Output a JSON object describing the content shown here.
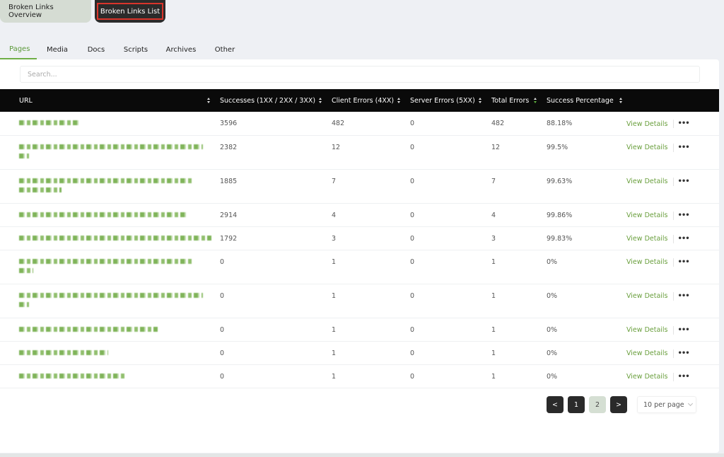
{
  "view_tabs": [
    {
      "label": "Broken Links Overview",
      "active": false
    },
    {
      "label": "Broken Links List",
      "active": true
    }
  ],
  "sub_tabs": [
    {
      "label": "Pages",
      "active": true
    },
    {
      "label": "Media",
      "active": false
    },
    {
      "label": "Docs",
      "active": false
    },
    {
      "label": "Scripts",
      "active": false
    },
    {
      "label": "Archives",
      "active": false
    },
    {
      "label": "Other",
      "active": false
    }
  ],
  "search": {
    "placeholder": "Search...",
    "value": ""
  },
  "table": {
    "columns": [
      {
        "label": "URL",
        "sortable": true
      },
      {
        "label": "Successes (1XX / 2XX / 3XX)",
        "sortable": true
      },
      {
        "label": "Client Errors (4XX)",
        "sortable": true
      },
      {
        "label": "Server Errors (5XX)",
        "sortable": true
      },
      {
        "label": "Total Errors",
        "sortable": true,
        "sorted": "desc"
      },
      {
        "label": "Success Percentage",
        "sortable": true
      }
    ],
    "rows": [
      {
        "url": "[obscured]",
        "successes": "3596",
        "client_errors": "482",
        "server_errors": "0",
        "total_errors": "482",
        "success_pct": "88.18%",
        "action": "View Details"
      },
      {
        "url": "[obscured]",
        "successes": "2382",
        "client_errors": "12",
        "server_errors": "0",
        "total_errors": "12",
        "success_pct": "99.5%",
        "action": "View Details"
      },
      {
        "url": "[obscured]",
        "successes": "1885",
        "client_errors": "7",
        "server_errors": "0",
        "total_errors": "7",
        "success_pct": "99.63%",
        "action": "View Details"
      },
      {
        "url": "[obscured]",
        "successes": "2914",
        "client_errors": "4",
        "server_errors": "0",
        "total_errors": "4",
        "success_pct": "99.86%",
        "action": "View Details"
      },
      {
        "url": "[obscured]",
        "successes": "1792",
        "client_errors": "3",
        "server_errors": "0",
        "total_errors": "3",
        "success_pct": "99.83%",
        "action": "View Details"
      },
      {
        "url": "[obscured]",
        "successes": "0",
        "client_errors": "1",
        "server_errors": "0",
        "total_errors": "1",
        "success_pct": "0%",
        "action": "View Details"
      },
      {
        "url": "[obscured]",
        "successes": "0",
        "client_errors": "1",
        "server_errors": "0",
        "total_errors": "1",
        "success_pct": "0%",
        "action": "View Details"
      },
      {
        "url": "[obscured]",
        "successes": "0",
        "client_errors": "1",
        "server_errors": "0",
        "total_errors": "1",
        "success_pct": "0%",
        "action": "View Details"
      },
      {
        "url": "[obscured]",
        "successes": "0",
        "client_errors": "1",
        "server_errors": "0",
        "total_errors": "1",
        "success_pct": "0%",
        "action": "View Details"
      },
      {
        "url": "[obscured]",
        "successes": "0",
        "client_errors": "1",
        "server_errors": "0",
        "total_errors": "1",
        "success_pct": "0%",
        "action": "View Details"
      }
    ]
  },
  "pagination": {
    "prev_icon": "chevron-left-icon",
    "next_icon": "chevron-right-icon",
    "prev_label": "<",
    "next_label": ">",
    "pages": [
      "1",
      "2"
    ],
    "current_page": "2",
    "per_page": "10 per page"
  },
  "colors": {
    "accent_green": "#6a9f3d",
    "header_bg": "#0a0a0a",
    "active_tab_outline": "#d9342b",
    "active_page_bg": "#d5dfd3"
  }
}
